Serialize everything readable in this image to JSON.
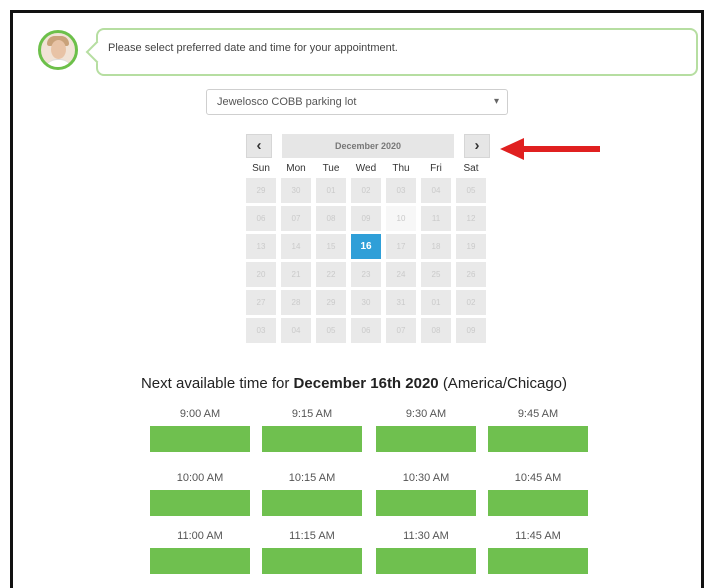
{
  "message": "Please select preferred date and time for your appointment.",
  "location": {
    "selected": "Jewelosco COBB parking lot"
  },
  "calendar": {
    "month_label": "December 2020",
    "prev_symbol": "‹",
    "next_symbol": "›",
    "weekdays": [
      "Sun",
      "Mon",
      "Tue",
      "Wed",
      "Thu",
      "Fri",
      "Sat"
    ],
    "weeks": [
      [
        "29",
        "30",
        "01",
        "02",
        "03",
        "04",
        "05"
      ],
      [
        "06",
        "07",
        "08",
        "09",
        "10",
        "11",
        "12"
      ],
      [
        "13",
        "14",
        "15",
        "16",
        "17",
        "18",
        "19"
      ],
      [
        "20",
        "21",
        "22",
        "23",
        "24",
        "25",
        "26"
      ],
      [
        "27",
        "28",
        "29",
        "30",
        "31",
        "01",
        "02"
      ],
      [
        "03",
        "04",
        "05",
        "06",
        "07",
        "08",
        "09"
      ]
    ],
    "selected_day": "16"
  },
  "availability": {
    "prefix": "Next available time for ",
    "date": "December 16th 2020",
    "timezone": "(America/Chicago)"
  },
  "slots": [
    [
      "9:00 AM",
      "9:15 AM",
      "9:30 AM",
      "9:45 AM"
    ],
    [
      "10:00 AM",
      "10:15 AM",
      "10:30 AM",
      "10:45 AM"
    ],
    [
      "11:00 AM",
      "11:15 AM",
      "11:30 AM",
      "11:45 AM"
    ]
  ],
  "colors": {
    "accent_green": "#6fc04f",
    "selected_blue": "#2f9fd8",
    "arrow_red": "#e02020"
  }
}
